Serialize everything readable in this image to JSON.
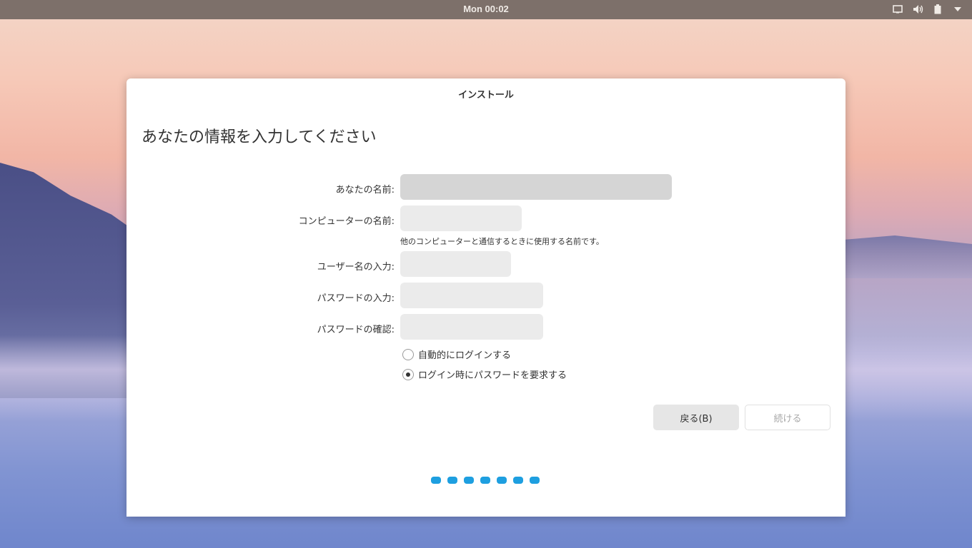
{
  "topbar": {
    "clock": "Mon 00:02",
    "tray_icons": [
      "display-icon",
      "volume-icon",
      "battery-icon",
      "menu-arrow-icon"
    ]
  },
  "window": {
    "title": "インストール",
    "heading": "あなたの情報を入力してください",
    "form": {
      "name_label": "あなたの名前:",
      "name_value": "",
      "computer_label": "コンピューターの名前:",
      "computer_value": "",
      "computer_hint": "他のコンピューターと通信するときに使用する名前です。",
      "username_label": "ユーザー名の入力:",
      "username_value": "",
      "password_label": "パスワードの入力:",
      "password_value": "",
      "confirm_label": "パスワードの確認:",
      "confirm_value": ""
    },
    "login_options": {
      "auto_login": "自動的にログインする",
      "require_password": "ログイン時にパスワードを要求する",
      "selected": "require_password"
    },
    "buttons": {
      "back": "戻る(B)",
      "continue": "続ける"
    },
    "progress_steps": 7,
    "accent_color": "#1e9fe0"
  }
}
